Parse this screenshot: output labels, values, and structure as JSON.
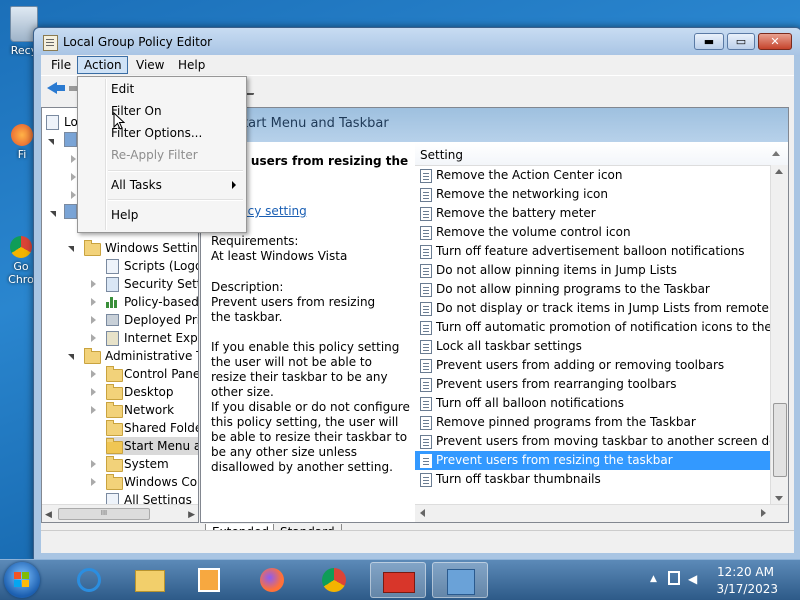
{
  "desktop": {
    "icons": [
      {
        "label": "Recy",
        "name": "recycle-bin-icon"
      },
      {
        "label": "Fi",
        "name": "firefox-desktop-icon"
      },
      {
        "label": "Go",
        "name": "chrome-desktop-icon"
      },
      {
        "label": "Chro",
        "name": "chrome-desktop-label"
      }
    ]
  },
  "window": {
    "title": "Local Group Policy Editor",
    "controls": {
      "minimize": "▬",
      "maximize": "▭",
      "close": "✕"
    }
  },
  "menubar": {
    "items": [
      "File",
      "Action",
      "View",
      "Help"
    ],
    "active": "Action"
  },
  "action_menu": {
    "items": [
      {
        "label": "Edit",
        "enabled": true
      },
      {
        "label": "Filter On",
        "enabled": true
      },
      {
        "label": "Filter Options...",
        "enabled": true
      },
      {
        "label": "Re-Apply Filter",
        "enabled": false
      },
      {
        "label": "All Tasks",
        "enabled": true,
        "submenu": true
      },
      {
        "label": "Help",
        "enabled": true
      }
    ]
  },
  "tree": {
    "items": [
      {
        "label": "Loc"
      },
      {
        "label": "Windows Setting"
      },
      {
        "label": "Scripts (Logon"
      },
      {
        "label": "Security Settin"
      },
      {
        "label": "Policy-based"
      },
      {
        "label": "Deployed Prin"
      },
      {
        "label": "Internet Explo"
      },
      {
        "label": "Administrative Te"
      },
      {
        "label": "Control Panel"
      },
      {
        "label": "Desktop"
      },
      {
        "label": "Network"
      },
      {
        "label": "Shared Folder"
      },
      {
        "label": "Start Menu ar"
      },
      {
        "label": "System"
      },
      {
        "label": "Windows Cor"
      },
      {
        "label": "All Settings"
      }
    ],
    "scroll_thumb_label": "III"
  },
  "header": {
    "title": "tart Menu and Taskbar"
  },
  "extended": {
    "policy_title": "t users from resizing the",
    "edit_link": "licy setting",
    "requirements_label": "Requirements:",
    "requirements_value": "At least Windows Vista",
    "description_label": "Description:",
    "description": "Prevent users from resizing the taskbar.",
    "para1": "If you enable this policy setting the user will not be able to resize their taskbar to be any other size.",
    "para2": "If you disable or do not configure this policy setting, the user will be able to resize their taskbar to be any other size unless disallowed by another setting."
  },
  "list": {
    "column": "Setting",
    "rows": [
      "Remove the Action Center icon",
      "Remove the networking icon",
      "Remove the battery meter",
      "Remove the volume control icon",
      "Turn off feature advertisement balloon notifications",
      "Do not allow pinning items in Jump Lists",
      "Do not allow pinning programs to the Taskbar",
      "Do not display or track items in Jump Lists from remote loca...",
      "Turn off automatic promotion of notification icons to the ta...",
      "Lock all taskbar settings",
      "Prevent users from adding or removing toolbars",
      "Prevent users from rearranging toolbars",
      "Turn off all balloon notifications",
      "Remove pinned programs from the Taskbar",
      "Prevent users from moving taskbar to another screen dock l...",
      "Prevent users from resizing the taskbar",
      "Turn off taskbar thumbnails"
    ],
    "selected_index": 15
  },
  "tabs": [
    "Extended",
    "Standard"
  ],
  "active_tab": "Extended",
  "taskbar": {
    "apps": [
      "internet-explorer",
      "file-explorer",
      "media-player",
      "firefox",
      "chrome",
      "toolbox",
      "network-tool"
    ],
    "time": "12:20 AM",
    "date": "3/17/2023"
  }
}
